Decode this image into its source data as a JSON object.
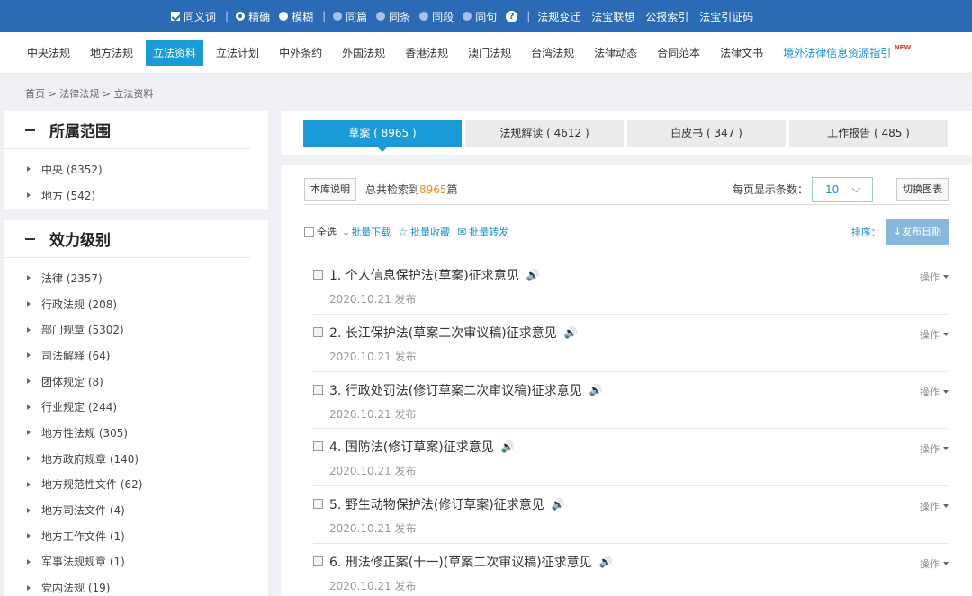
{
  "topbar": {
    "synonym": "同义词",
    "exact": "精确",
    "fuzzy": "模糊",
    "scopes": [
      "同篇",
      "同条",
      "同段",
      "同句"
    ],
    "links": [
      "法规变迁",
      "法宝联想",
      "公报索引",
      "法宝引证码"
    ]
  },
  "nav": [
    "中央法规",
    "地方法规",
    "立法资料",
    "立法计划",
    "中外条约",
    "外国法规",
    "香港法规",
    "澳门法规",
    "台湾法规",
    "法律动态",
    "合同范本",
    "法律文书"
  ],
  "nav_special": "境外法律信息资源指引",
  "nav_new": "NEW",
  "breadcrumb": "首页 > 法律法规 > 立法资料",
  "scope_panel": {
    "title": "所属范围",
    "items": [
      "中央 (8352)",
      "地方 (542)"
    ]
  },
  "level_panel": {
    "title": "效力级别",
    "items": [
      "法律 (2357)",
      "行政法规 (208)",
      "部门规章 (5302)",
      "司法解释 (64)",
      "团体规定 (8)",
      "行业规定 (244)",
      "地方性法规 (305)",
      "地方政府规章 (140)",
      "地方规范性文件 (62)",
      "地方司法文件 (4)",
      "地方工作文件 (1)",
      "军事法规规章 (1)",
      "党内法规 (19)"
    ]
  },
  "tabs": [
    "草案 ( 8965 )",
    "法规解读 ( 4612 )",
    "白皮书 ( 347 )",
    "工作报告 ( 485 )"
  ],
  "info": {
    "about_btn": "本库说明",
    "total_prefix": "总共检索到",
    "total_num": "8965",
    "total_suffix": "篇",
    "per_page_label": "每页显示条数：",
    "per_page_value": "10",
    "switch_btn": "切换图表"
  },
  "tools": {
    "select_all": "全选",
    "download": "批量下载",
    "favorite": "批量收藏",
    "forward": "批量转发",
    "sort_label": "排序：",
    "sort_value": "↓发布日期"
  },
  "results": [
    {
      "title": "1. 个人信息保护法(草案)征求意见",
      "date": "2020.10.21 发布",
      "ops": "操作"
    },
    {
      "title": "2. 长江保护法(草案二次审议稿)征求意见",
      "date": "2020.10.21 发布",
      "ops": "操作"
    },
    {
      "title": "3. 行政处罚法(修订草案二次审议稿)征求意见",
      "date": "2020.10.21 发布",
      "ops": "操作"
    },
    {
      "title": "4. 国防法(修订草案)征求意见",
      "date": "2020.10.21 发布",
      "ops": "操作"
    },
    {
      "title": "5. 野生动物保护法(修订草案)征求意见",
      "date": "2020.10.21 发布",
      "ops": "操作"
    },
    {
      "title": "6. 刑法修正案(十一)(草案二次审议稿)征求意见",
      "date": "2020.10.21 发布",
      "ops": "操作"
    }
  ]
}
